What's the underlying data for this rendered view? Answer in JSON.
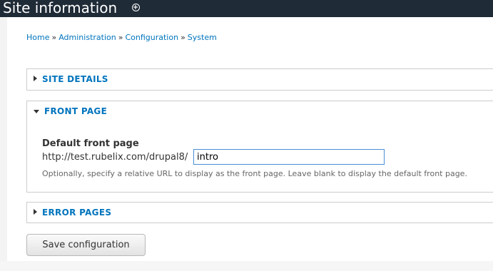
{
  "header": {
    "title": "Site information",
    "icon": "plus-circle-icon"
  },
  "breadcrumb": {
    "items": [
      "Home",
      "Administration",
      "Configuration",
      "System"
    ],
    "separator": "»"
  },
  "sections": {
    "site_details": {
      "label": "SITE DETAILS",
      "expanded": false
    },
    "front_page": {
      "label": "FRONT PAGE",
      "expanded": true,
      "field": {
        "label": "Default front page",
        "prefix": "http://test.rubelix.com/drupal8/",
        "value": "intro",
        "description": "Optionally, specify a relative URL to display as the front page. Leave blank to display the default front page."
      }
    },
    "error_pages": {
      "label": "ERROR PAGES",
      "expanded": false
    }
  },
  "actions": {
    "save_label": "Save configuration"
  },
  "colors": {
    "header_bg": "#1f2b37",
    "link": "#0074bd",
    "input_focus_border": "#4a8fd4"
  }
}
